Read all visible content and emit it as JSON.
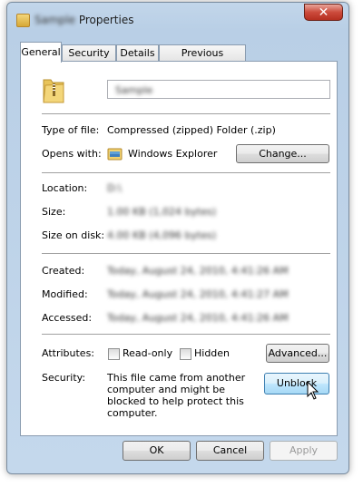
{
  "window": {
    "title_prefix": "Sample",
    "title_suffix": "Properties",
    "close_glyph": "✕"
  },
  "tabs": [
    {
      "label": "General",
      "active": true
    },
    {
      "label": "Security",
      "active": false
    },
    {
      "label": "Details",
      "active": false
    },
    {
      "label": "Previous Versions",
      "active": false
    }
  ],
  "general": {
    "name_value": "Sample",
    "type_label": "Type of file:",
    "type_value": "Compressed (zipped) Folder (.zip)",
    "opens_label": "Opens with:",
    "opens_value": "Windows Explorer",
    "change_button": "Change...",
    "location_label": "Location:",
    "location_value": "D:\\",
    "size_label": "Size:",
    "size_value": "1.00 KB (1,024 bytes)",
    "size_on_disk_label": "Size on disk:",
    "size_on_disk_value": "4.00 KB (4,096 bytes)",
    "created_label": "Created:",
    "created_value": "Today, August 24, 2010, 4:41:26 AM",
    "modified_label": "Modified:",
    "modified_value": "Today, August 24, 2010, 4:41:27 AM",
    "accessed_label": "Accessed:",
    "accessed_value": "Today, August 24, 2010, 4:41:26 AM",
    "attributes_label": "Attributes:",
    "readonly_label": "Read-only",
    "hidden_label": "Hidden",
    "advanced_button": "Advanced...",
    "security_label": "Security:",
    "security_text": "This file came from another computer and might be blocked to help protect this computer.",
    "unblock_button": "Unblock"
  },
  "footer": {
    "ok": "OK",
    "cancel": "Cancel",
    "apply": "Apply"
  },
  "icons": {
    "title": "folder-zip-icon",
    "main": "zip-folder-icon",
    "opens_with": "windows-explorer-icon",
    "cursor": "mouse-pointer-icon"
  },
  "colors": {
    "window_frame": "#c2d6ea",
    "close_button": "#cc4b3c",
    "hover_button": "#bee6fd"
  }
}
